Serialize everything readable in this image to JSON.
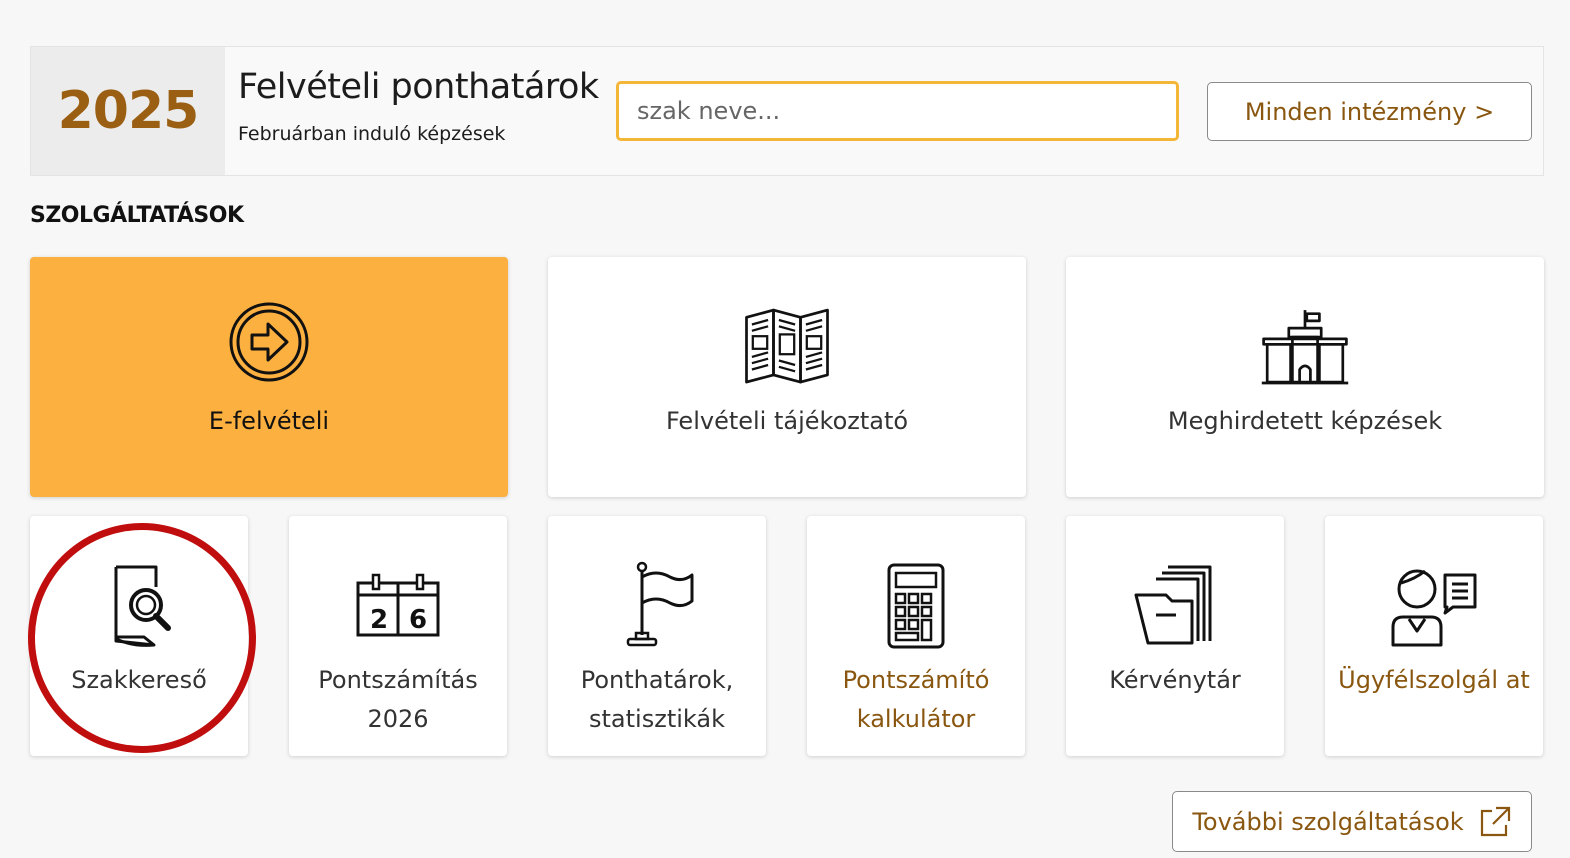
{
  "header": {
    "year": "2025",
    "title": "Felvételi ponthatárok",
    "subtitle": "Februárban induló képzések",
    "search_placeholder": "szak neve...",
    "all_institutions_label": "Minden intézmény >"
  },
  "section_title": "SZOLGÁLTATÁSOK",
  "big_tiles": [
    {
      "label": "E-felvételi",
      "icon": "arrow-circle-icon"
    },
    {
      "label": "Felvételi tájékoztató",
      "icon": "brochure-icon"
    },
    {
      "label": "Meghirdetett képzések",
      "icon": "university-building-icon"
    }
  ],
  "small_tiles": [
    {
      "label": "Szakkereső",
      "icon": "document-search-icon"
    },
    {
      "label": "Pontszámítás 2026",
      "icon": "calendar-icon",
      "calendar_digits": [
        "2",
        "6"
      ]
    },
    {
      "label": "Ponthatárok, statisztikák",
      "icon": "flag-icon"
    },
    {
      "label": "Pontszámító kalkulátor",
      "icon": "calculator-icon"
    },
    {
      "label": "Kérvénytár",
      "icon": "folder-icon"
    },
    {
      "label": "Ügyfélszolgál at",
      "icon": "customer-service-icon"
    }
  ],
  "more_services_label": "További szolgáltatások",
  "colors": {
    "accent_orange": "#fbb040",
    "gold_text": "#8a5710",
    "year_text": "#9a5f12",
    "search_border": "#f4b636",
    "annotation_red": "#c00d0d"
  }
}
